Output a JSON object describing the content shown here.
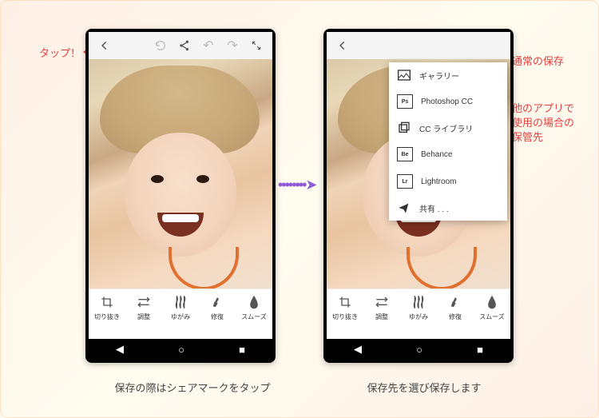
{
  "annotations": {
    "tap": "タップ！",
    "normal_save": "通常の保存",
    "other_app_storage": "他のアプリで使用の場合の保管先"
  },
  "toolbar": {
    "back": "‹",
    "restore": "⟲",
    "share": "",
    "undo": "↶",
    "redo": "↷",
    "fullscreen": "⤢"
  },
  "tools": [
    {
      "icon": "crop",
      "label": "切り抜き"
    },
    {
      "icon": "adjust",
      "label": "調整"
    },
    {
      "icon": "warp",
      "label": "ゆがみ"
    },
    {
      "icon": "heal",
      "label": "修復"
    },
    {
      "icon": "smooth",
      "label": "スムーズ"
    }
  ],
  "menu": [
    {
      "icon": "gallery-icon",
      "label": "ギャラリー"
    },
    {
      "icon": "ps-icon",
      "label": "Photoshop CC"
    },
    {
      "icon": "lib-icon",
      "label": "CC ライブラリ"
    },
    {
      "icon": "be-icon",
      "label": "Behance"
    },
    {
      "icon": "lr-icon",
      "label": "Lightroom"
    },
    {
      "icon": "share-icon",
      "label": "共有 . . ."
    }
  ],
  "captions": {
    "left": "保存の際はシェアマークをタップ",
    "right": "保存先を選び保存します"
  }
}
